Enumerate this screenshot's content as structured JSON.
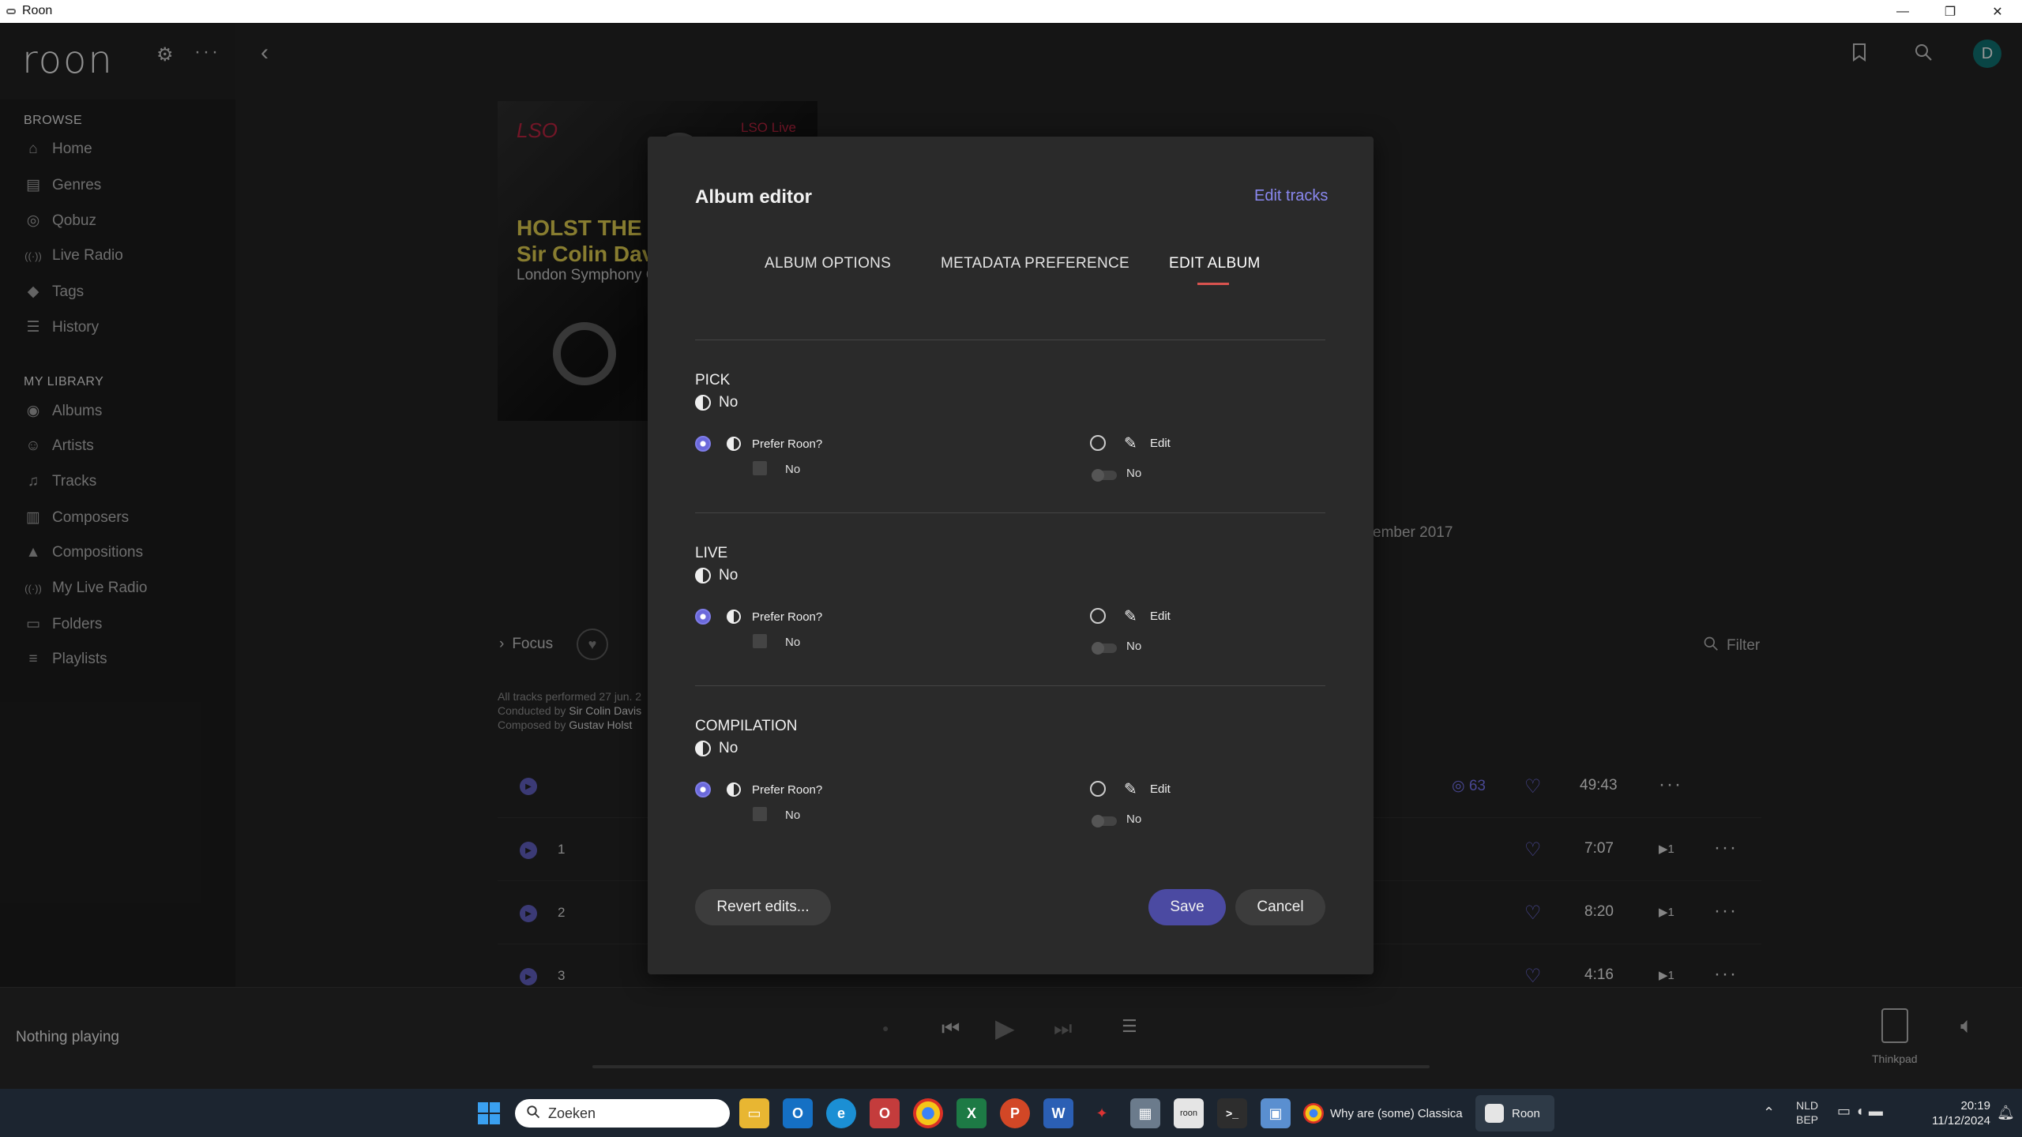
{
  "window": {
    "title": "Roon",
    "minimize": "—",
    "restore": "❐",
    "close": "✕"
  },
  "header": {
    "logo": "roon",
    "avatar": "D"
  },
  "sidebar": {
    "browse_title": "BROWSE",
    "browse": [
      {
        "label": "Home",
        "icon": "home-icon",
        "glyph": "⌂"
      },
      {
        "label": "Genres",
        "icon": "genres-icon",
        "glyph": "▤"
      },
      {
        "label": "Qobuz",
        "icon": "qobuz-icon",
        "glyph": "◎"
      },
      {
        "label": "Live Radio",
        "icon": "radio-icon",
        "glyph": "((·))"
      },
      {
        "label": "Tags",
        "icon": "tag-icon",
        "glyph": "◆"
      },
      {
        "label": "History",
        "icon": "history-icon",
        "glyph": "☰"
      }
    ],
    "library_title": "MY LIBRARY",
    "library": [
      {
        "label": "Albums",
        "icon": "albums-icon",
        "glyph": "◉"
      },
      {
        "label": "Artists",
        "icon": "artists-icon",
        "glyph": "☺"
      },
      {
        "label": "Tracks",
        "icon": "tracks-icon",
        "glyph": "♫"
      },
      {
        "label": "Composers",
        "icon": "composers-icon",
        "glyph": "▥"
      },
      {
        "label": "Compositions",
        "icon": "compositions-icon",
        "glyph": "▲"
      },
      {
        "label": "My Live Radio",
        "icon": "my-radio-icon",
        "glyph": "((·))"
      },
      {
        "label": "Folders",
        "icon": "folder-icon",
        "glyph": "▭"
      },
      {
        "label": "Playlists",
        "icon": "playlist-icon",
        "glyph": "≡"
      }
    ]
  },
  "album": {
    "cover_logo": "LSO",
    "cover_live": "LSO Live",
    "cover_line1": "HOLST THE PLA",
    "cover_line2": "Sir Colin Dav",
    "cover_line3": "London Symphony C",
    "date_fragment": "ember 2017",
    "focus": "Focus",
    "filter": "Filter",
    "credits_line1": "All tracks performed 27 jun. 2",
    "credits_conducted_prefix": "Conducted by",
    "credits_conducted": "Sir Colin Davis",
    "credits_composed_prefix": "Composed by",
    "credits_composed": "Gustav Holst",
    "summary": {
      "count": "63",
      "duration": "49:43"
    },
    "tracks": [
      {
        "num": "1",
        "duration": "7:07",
        "plays": "1"
      },
      {
        "num": "2",
        "duration": "8:20",
        "plays": "1"
      },
      {
        "num": "3",
        "duration": "4:16",
        "plays": "1"
      }
    ]
  },
  "modal": {
    "title": "Album editor",
    "edit_tracks": "Edit tracks",
    "tabs": [
      "ALBUM OPTIONS",
      "METADATA PREFERENCE",
      "EDIT ALBUM"
    ],
    "sections": [
      {
        "title": "PICK",
        "value": "No",
        "prefer_label": "Prefer Roon?",
        "prefer_value": "No",
        "edit_label": "Edit",
        "edit_value": "No"
      },
      {
        "title": "LIVE",
        "value": "No",
        "prefer_label": "Prefer Roon?",
        "prefer_value": "No",
        "edit_label": "Edit",
        "edit_value": "No"
      },
      {
        "title": "COMPILATION",
        "value": "No",
        "prefer_label": "Prefer Roon?",
        "prefer_value": "No",
        "edit_label": "Edit",
        "edit_value": "No"
      }
    ],
    "revert": "Revert edits...",
    "save": "Save",
    "cancel": "Cancel"
  },
  "player": {
    "status": "Nothing playing",
    "zone": "Thinkpad"
  },
  "taskbar": {
    "search_placeholder": "Zoeken",
    "chrome_window": "Why are (some) Classica",
    "roon_window": "Roon",
    "lang1": "NLD",
    "lang2": "BEP",
    "time": "20:19",
    "date": "11/12/2024"
  },
  "colors": {
    "accent": "#6b69db",
    "tab_indicator": "#d9534f",
    "link": "#8a88f0"
  }
}
